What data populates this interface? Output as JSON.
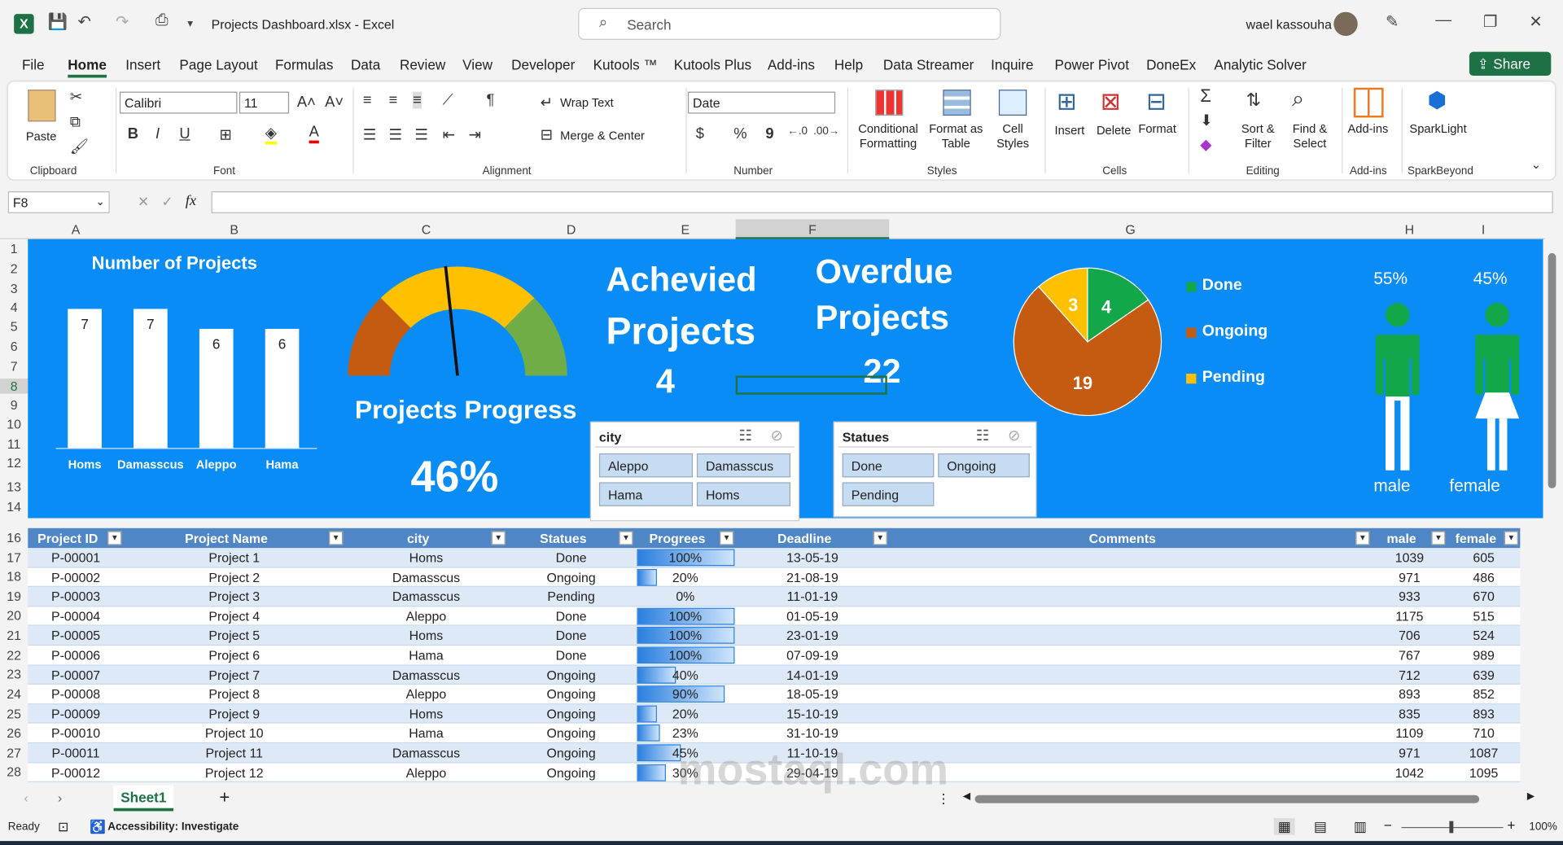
{
  "app": {
    "title": "Projects Dashboard.xlsx - Excel",
    "search_placeholder": "Search",
    "user": "wael kassouha",
    "share": "Share"
  },
  "menu": [
    "File",
    "Home",
    "Insert",
    "Page Layout",
    "Formulas",
    "Data",
    "Review",
    "View",
    "Developer",
    "Kutools ™",
    "Kutools Plus",
    "Add-ins",
    "Help",
    "Data Streamer",
    "Inquire",
    "Power Pivot",
    "DoneEx",
    "Analytic Solver"
  ],
  "ribbon": {
    "clipboard": {
      "label": "Clipboard",
      "paste": "Paste"
    },
    "font": {
      "label": "Font",
      "name": "Calibri",
      "size": "11",
      "bold": "B",
      "italic": "I",
      "underline": "U"
    },
    "alignment": {
      "label": "Alignment",
      "wrap": "Wrap Text",
      "merge": "Merge & Center"
    },
    "number": {
      "label": "Number",
      "format": "Date",
      "currency": "$",
      "percent": "%",
      "comma": "9"
    },
    "styles": {
      "label": "Styles",
      "cond": "Conditional Formatting",
      "table": "Format as Table",
      "cell": "Cell Styles"
    },
    "cells": {
      "label": "Cells",
      "insert": "Insert",
      "delete": "Delete",
      "format": "Format"
    },
    "editing": {
      "label": "Editing",
      "sort": "Sort & Filter",
      "find": "Find & Select"
    },
    "addins": {
      "label": "Add-ins",
      "btn": "Add-ins"
    },
    "sparkbeyond": {
      "label": "SparkBeyond",
      "btn": "SparkLight"
    }
  },
  "formula": {
    "namebox": "F8",
    "fx": "fx"
  },
  "columns": [
    "A",
    "B",
    "C",
    "D",
    "E",
    "F",
    "G",
    "H",
    "I"
  ],
  "rows": [
    "1",
    "2",
    "3",
    "4",
    "5",
    "6",
    "7",
    "8",
    "9",
    "10",
    "11",
    "12",
    "13",
    "14",
    "16",
    "17",
    "18",
    "19",
    "20",
    "21",
    "22",
    "23",
    "24",
    "25",
    "26",
    "27",
    "28"
  ],
  "dashboard": {
    "bar_title": "Number of Projects",
    "gauge_title": "Projects Progress",
    "gauge_value": "46%",
    "achieved_label1": "Achevied",
    "achieved_label2": "Projects",
    "achieved_value": "4",
    "overdue_label1": "Overdue",
    "overdue_label2": "Projects",
    "overdue_value": "22",
    "male_pct": "55%",
    "female_pct": "45%",
    "male": "male",
    "female": "female"
  },
  "chart_data": [
    {
      "type": "bar",
      "categories": [
        "Homs",
        "Damasscus",
        "Aleppo",
        "Hama"
      ],
      "values": [
        7,
        7,
        6,
        6
      ],
      "title": "Number of Projects"
    },
    {
      "type": "pie",
      "categories": [
        "Done",
        "Ongoing",
        "Pending"
      ],
      "values": [
        4,
        19,
        3
      ],
      "colors": [
        "#12a84a",
        "#c55a11",
        "#ffc000"
      ],
      "legend": "right"
    }
  ],
  "slicers": {
    "city": {
      "title": "city",
      "items": [
        "Aleppo",
        "Damasscus",
        "Hama",
        "Homs"
      ]
    },
    "status": {
      "title": "Statues",
      "items": [
        "Done",
        "Ongoing",
        "Pending"
      ]
    }
  },
  "table": {
    "headers": [
      "Project ID",
      "Project Name",
      "city",
      "Statues",
      "Progrees",
      "Deadline",
      "Comments",
      "male",
      "female"
    ],
    "rows": [
      [
        "P-00001",
        "Project 1",
        "Homs",
        "Done",
        "100%",
        "13-05-19",
        "1039",
        "605"
      ],
      [
        "P-00002",
        "Project 2",
        "Damasscus",
        "Ongoing",
        "20%",
        "21-08-19",
        "971",
        "486"
      ],
      [
        "P-00003",
        "Project 3",
        "Damasscus",
        "Pending",
        "0%",
        "11-01-19",
        "933",
        "670"
      ],
      [
        "P-00004",
        "Project 4",
        "Aleppo",
        "Done",
        "100%",
        "01-05-19",
        "1175",
        "515"
      ],
      [
        "P-00005",
        "Project 5",
        "Homs",
        "Done",
        "100%",
        "23-01-19",
        "706",
        "524"
      ],
      [
        "P-00006",
        "Project 6",
        "Hama",
        "Done",
        "100%",
        "07-09-19",
        "767",
        "989"
      ],
      [
        "P-00007",
        "Project 7",
        "Damasscus",
        "Ongoing",
        "40%",
        "14-01-19",
        "712",
        "639"
      ],
      [
        "P-00008",
        "Project 8",
        "Aleppo",
        "Ongoing",
        "90%",
        "18-05-19",
        "893",
        "852"
      ],
      [
        "P-00009",
        "Project 9",
        "Homs",
        "Ongoing",
        "20%",
        "15-10-19",
        "835",
        "893"
      ],
      [
        "P-00010",
        "Project 10",
        "Hama",
        "Ongoing",
        "23%",
        "31-10-19",
        "1109",
        "710"
      ],
      [
        "P-00011",
        "Project 11",
        "Damasscus",
        "Ongoing",
        "45%",
        "11-10-19",
        "971",
        "1087"
      ],
      [
        "P-00012",
        "Project 12",
        "Aleppo",
        "Ongoing",
        "30%",
        "29-04-19",
        "1042",
        "1095"
      ]
    ]
  },
  "sheet": {
    "tab": "Sheet1"
  },
  "status": {
    "ready": "Ready",
    "accessibility": "Accessibility: Investigate",
    "zoom": "100%"
  },
  "watermark": "mostaql.com",
  "colors": {
    "excel_green": "#1e7145",
    "dash_blue": "#0a8cf7",
    "table_header": "#4f86c6",
    "done": "#12a84a",
    "ongoing": "#c55a11",
    "pending": "#ffc000"
  }
}
